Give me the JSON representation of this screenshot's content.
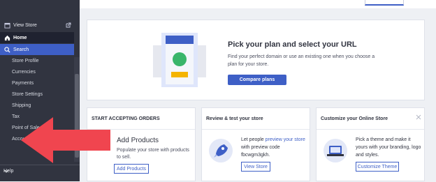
{
  "sidebar": {
    "view_store": "View Store",
    "home": "Home",
    "search": "Search",
    "items": [
      {
        "label": "Store Profile"
      },
      {
        "label": "Currencies"
      },
      {
        "label": "Payments"
      },
      {
        "label": "Store Settings"
      },
      {
        "label": "Shipping"
      },
      {
        "label": "Tax"
      },
      {
        "label": "Point of Sale"
      },
      {
        "label": "Accounting"
      }
    ],
    "help": "Help"
  },
  "hero": {
    "title": "Pick your plan and select your URL",
    "description": "Find your perfect domain or use an existing one when you choose a plan for your store.",
    "button": "Compare plans"
  },
  "cards": {
    "accept_orders": {
      "header": "START ACCEPTING ORDERS",
      "title": "Add Products",
      "text": "Populate your store with products to sell.",
      "button": "Add Products"
    },
    "review": {
      "header": "Review & test your store",
      "text_before": "Let people ",
      "link": "preview your store",
      "text_after": " with preview code",
      "code": "fbcwgm3gkh.",
      "button": "View Store"
    },
    "customize": {
      "header": "Customize your Online Store",
      "text": "Pick a theme and make it yours with your branding, logo and styles.",
      "button": "Customize Theme"
    }
  },
  "colors": {
    "sidebar_bg": "#313440",
    "accent": "#3e5fc6",
    "arrow": "#f0454f"
  },
  "icons": {
    "view_store": "storefront-icon",
    "external": "external-link-icon",
    "home": "home-icon",
    "search": "search-icon",
    "close": "close-icon",
    "help": "chevron-down-icon"
  }
}
